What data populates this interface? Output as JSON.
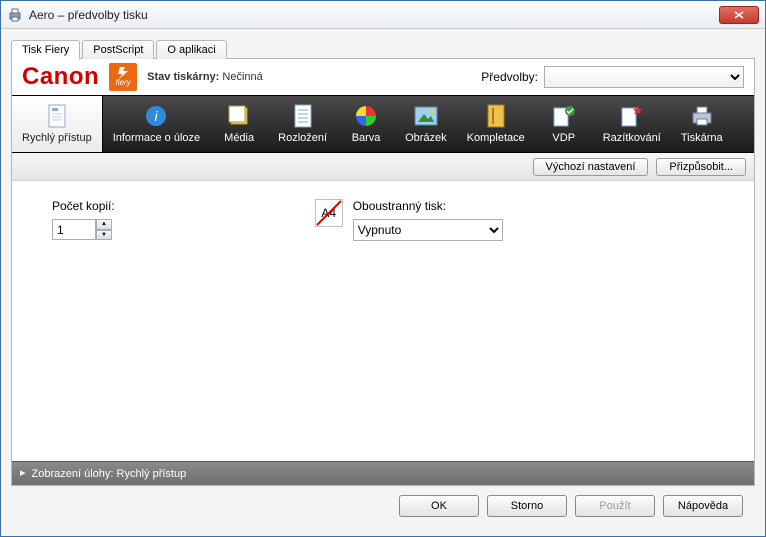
{
  "window": {
    "title": "Aero – předvolby tisku"
  },
  "tabs": [
    {
      "label": "Tisk Fiery"
    },
    {
      "label": "PostScript"
    },
    {
      "label": "O aplikaci"
    }
  ],
  "brand": {
    "logo_text": "Canon",
    "fiery_text": "fiery",
    "status_label": "Stav tiskárny:",
    "status_value": "Nečinná",
    "presets_label": "Předvolby:"
  },
  "ribbon": [
    {
      "label": "Rychlý přístup"
    },
    {
      "label": "Informace o úloze"
    },
    {
      "label": "Média"
    },
    {
      "label": "Rozložení"
    },
    {
      "label": "Barva"
    },
    {
      "label": "Obrázek"
    },
    {
      "label": "Kompletace"
    },
    {
      "label": "VDP"
    },
    {
      "label": "Razítkování"
    },
    {
      "label": "Tiskárna"
    }
  ],
  "subbar": {
    "defaults": "Výchozí nastavení",
    "customize": "Přizpůsobit..."
  },
  "fields": {
    "copies_label": "Počet kopií:",
    "copies_value": "1",
    "duplex_label": "Oboustranný tisk:",
    "duplex_value": "Vypnuto",
    "duplex_icon_text": "A4"
  },
  "footer": {
    "text": "Zobrazení úlohy: Rychlý přístup"
  },
  "buttons": {
    "ok": "OK",
    "cancel": "Storno",
    "apply": "Použít",
    "help": "Nápověda"
  },
  "colors": {
    "brand_red": "#d30000",
    "fiery_orange": "#e96a12"
  }
}
